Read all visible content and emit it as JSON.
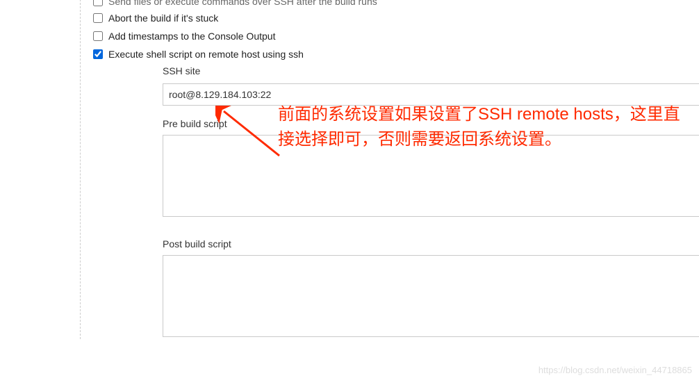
{
  "checkboxes": {
    "send_files": {
      "label": "Send files or execute commands over SSH after the build runs",
      "checked": false
    },
    "abort_stuck": {
      "label": "Abort the build if it's stuck",
      "checked": false
    },
    "add_timestamps": {
      "label": "Add timestamps to the Console Output",
      "checked": false
    },
    "execute_ssh": {
      "label": "Execute shell script on remote host using ssh",
      "checked": true
    }
  },
  "ssh_section": {
    "site_label": "SSH site",
    "site_value": "root@8.129.184.103:22",
    "pre_build_label": "Pre build script",
    "pre_build_value": "",
    "post_build_label": "Post build script",
    "post_build_value": ""
  },
  "annotation": {
    "text": "前面的系统设置如果设置了SSH remote hosts，这里直接选择即可，否则需要返回系统设置。"
  },
  "watermark": "https://blog.csdn.net/weixin_44718865"
}
